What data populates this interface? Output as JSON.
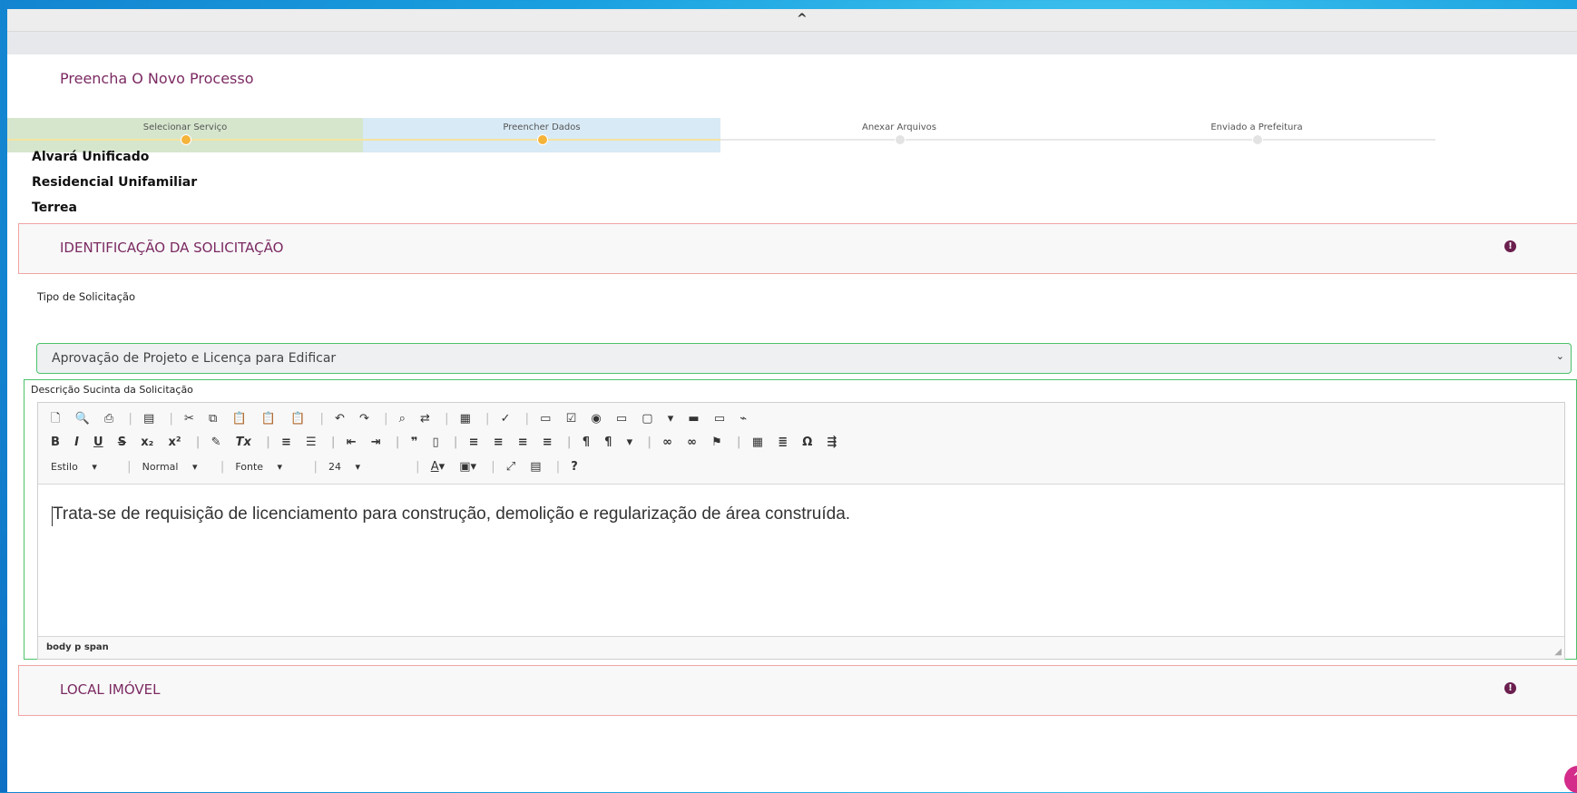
{
  "top_bar": {
    "chevron": "^"
  },
  "page": {
    "title": "Preencha O Novo Processo"
  },
  "steps": [
    {
      "label": "Selecionar Serviço"
    },
    {
      "label": "Preencher Dados"
    },
    {
      "label": "Anexar Arquivos"
    },
    {
      "label": "Enviado a Prefeitura"
    }
  ],
  "service": {
    "line1": "Alvará Unificado",
    "line2": "Residencial Unifamiliar",
    "line3": "Terrea"
  },
  "sections": {
    "identificacao": {
      "title": "IDENTIFICAÇÃO DA SOLICITAÇÃO",
      "icon": "!"
    },
    "local": {
      "title": "LOCAL IMÓVEL",
      "icon": "!"
    }
  },
  "tipo": {
    "label": "Tipo de Solicitação",
    "value": "Aprovação de Projeto e Licença para Edificar",
    "chevron": "⌄"
  },
  "descricao": {
    "label": "Descrição Sucinta da Solicitação",
    "text": "Trata-se de requisição de licenciamento para construção, demolição e regularização de área construída.",
    "status_path": "body  p  span",
    "combos": {
      "estilo": "Estilo",
      "formato": "Normal",
      "fonte": "Fonte",
      "tamanho": "24"
    }
  },
  "colors": {
    "accent": "#7b2a62",
    "step_active": "#f5b33a",
    "section_border": "#f2a4a4",
    "field_border": "#4cc26a"
  }
}
